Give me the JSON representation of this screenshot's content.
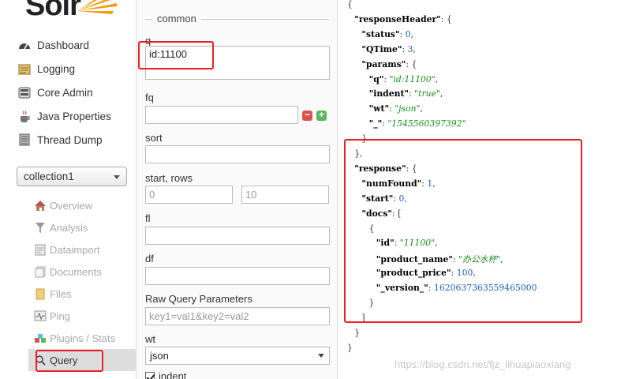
{
  "logo": {
    "text": "Solr"
  },
  "nav": {
    "items": [
      {
        "label": "Dashboard",
        "icon": "dashboard-icon"
      },
      {
        "label": "Logging",
        "icon": "logging-icon"
      },
      {
        "label": "Core Admin",
        "icon": "core-admin-icon"
      },
      {
        "label": "Java Properties",
        "icon": "java-icon"
      },
      {
        "label": "Thread Dump",
        "icon": "thread-dump-icon"
      }
    ],
    "core_selector": {
      "selected": "collection1"
    },
    "core_menu": [
      {
        "label": "Overview",
        "icon": "home-icon"
      },
      {
        "label": "Analysis",
        "icon": "funnel-icon"
      },
      {
        "label": "Dataimport",
        "icon": "dataimport-icon"
      },
      {
        "label": "Documents",
        "icon": "documents-icon"
      },
      {
        "label": "Files",
        "icon": "files-icon"
      },
      {
        "label": "Ping",
        "icon": "ping-icon"
      },
      {
        "label": "Plugins / Stats",
        "icon": "plugins-icon"
      },
      {
        "label": "Query",
        "icon": "query-icon"
      }
    ]
  },
  "form": {
    "legend": "common",
    "q": {
      "label": "q",
      "value": "id:11100"
    },
    "fq": {
      "label": "fq",
      "value": ""
    },
    "sort": {
      "label": "sort",
      "value": ""
    },
    "start_rows": {
      "label": "start, rows",
      "start_placeholder": "0",
      "rows_placeholder": "10"
    },
    "fl": {
      "label": "fl",
      "value": ""
    },
    "df": {
      "label": "df",
      "value": ""
    },
    "raw": {
      "label": "Raw Query Parameters",
      "placeholder": "key1=val1&key2=val2"
    },
    "wt": {
      "label": "wt",
      "selected": "json"
    },
    "indent": {
      "label": "indent",
      "checked": true
    }
  },
  "response": {
    "lines": [
      {
        "indent": 0,
        "parts": [
          [
            "p",
            "{"
          ]
        ]
      },
      {
        "indent": 1,
        "parts": [
          [
            "k",
            "\"responseHeader\""
          ],
          [
            "p",
            ": {"
          ]
        ]
      },
      {
        "indent": 2,
        "parts": [
          [
            "k",
            "\"status\""
          ],
          [
            "p",
            ": "
          ],
          [
            "n",
            "0"
          ],
          [
            "p",
            ","
          ]
        ]
      },
      {
        "indent": 2,
        "parts": [
          [
            "k",
            "\"QTime\""
          ],
          [
            "p",
            ": "
          ],
          [
            "n",
            "3"
          ],
          [
            "p",
            ","
          ]
        ]
      },
      {
        "indent": 2,
        "parts": [
          [
            "k",
            "\"params\""
          ],
          [
            "p",
            ": {"
          ]
        ]
      },
      {
        "indent": 3,
        "parts": [
          [
            "k",
            "\"q\""
          ],
          [
            "p",
            ": "
          ],
          [
            "s",
            "\"id:11100\""
          ],
          [
            "p",
            ","
          ]
        ]
      },
      {
        "indent": 3,
        "parts": [
          [
            "k",
            "\"indent\""
          ],
          [
            "p",
            ": "
          ],
          [
            "s",
            "\"true\""
          ],
          [
            "p",
            ","
          ]
        ]
      },
      {
        "indent": 3,
        "parts": [
          [
            "k",
            "\"wt\""
          ],
          [
            "p",
            ": "
          ],
          [
            "s",
            "\"json\""
          ],
          [
            "p",
            ","
          ]
        ]
      },
      {
        "indent": 3,
        "parts": [
          [
            "k",
            "\"_\""
          ],
          [
            "p",
            ": "
          ],
          [
            "s",
            "\"1545560397392\""
          ]
        ]
      },
      {
        "indent": 2,
        "parts": [
          [
            "p",
            "}"
          ]
        ]
      },
      {
        "indent": 1,
        "parts": [
          [
            "p",
            "},"
          ]
        ]
      },
      {
        "indent": 1,
        "parts": [
          [
            "k",
            "\"response\""
          ],
          [
            "p",
            ": {"
          ]
        ]
      },
      {
        "indent": 2,
        "parts": [
          [
            "k",
            "\"numFound\""
          ],
          [
            "p",
            ": "
          ],
          [
            "n",
            "1"
          ],
          [
            "p",
            ","
          ]
        ]
      },
      {
        "indent": 2,
        "parts": [
          [
            "k",
            "\"start\""
          ],
          [
            "p",
            ": "
          ],
          [
            "n",
            "0"
          ],
          [
            "p",
            ","
          ]
        ]
      },
      {
        "indent": 2,
        "parts": [
          [
            "k",
            "\"docs\""
          ],
          [
            "p",
            ": ["
          ]
        ]
      },
      {
        "indent": 3,
        "parts": [
          [
            "p",
            "{"
          ]
        ]
      },
      {
        "indent": 4,
        "parts": [
          [
            "k",
            "\"id\""
          ],
          [
            "p",
            ": "
          ],
          [
            "s",
            "\"11100\""
          ],
          [
            "p",
            ","
          ]
        ]
      },
      {
        "indent": 4,
        "parts": [
          [
            "k",
            "\"product_name\""
          ],
          [
            "p",
            ": "
          ],
          [
            "s",
            "\"办公水杯\""
          ],
          [
            "p",
            ","
          ]
        ]
      },
      {
        "indent": 4,
        "parts": [
          [
            "k",
            "\"product_price\""
          ],
          [
            "p",
            ": "
          ],
          [
            "n",
            "100"
          ],
          [
            "p",
            ","
          ]
        ]
      },
      {
        "indent": 4,
        "parts": [
          [
            "k",
            "\"_version_\""
          ],
          [
            "p",
            ": "
          ],
          [
            "n",
            "1620637363559465000"
          ]
        ]
      },
      {
        "indent": 3,
        "parts": [
          [
            "p",
            "}"
          ]
        ]
      },
      {
        "indent": 2,
        "parts": [
          [
            "p",
            "]"
          ]
        ]
      },
      {
        "indent": 1,
        "parts": [
          [
            "p",
            "}"
          ]
        ]
      },
      {
        "indent": 0,
        "parts": [
          [
            "p",
            "}"
          ]
        ]
      }
    ]
  },
  "watermark": "https://blog.csdn.net/fjz_lihuapiaoxiang",
  "colors": {
    "annotation_red": "#e8202a",
    "json_string": "#1a8a1a",
    "json_number": "#1a5fb4"
  }
}
